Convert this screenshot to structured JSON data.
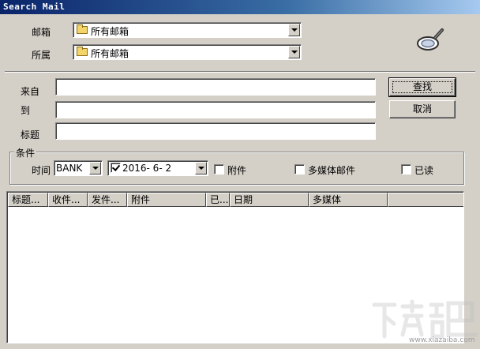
{
  "window": {
    "title": "Search Mail"
  },
  "fields": {
    "mailbox_label": "邮箱",
    "mailbox_value": "所有邮箱",
    "belongs_label": "所属",
    "belongs_value": "所有邮箱",
    "from_label": "来自",
    "to_label": "到",
    "subject_label": "标题",
    "from_value": "",
    "to_value": "",
    "subject_value": ""
  },
  "buttons": {
    "search": "查找",
    "cancel": "取消"
  },
  "conditions": {
    "group_label": "条件",
    "time_label": "时间",
    "time_value": "BANK",
    "date_checked": true,
    "date_value": "2016-  6-  2",
    "attachment_label": "附件",
    "attachment_checked": false,
    "multimedia_label": "多媒体邮件",
    "multimedia_checked": false,
    "read_label": "已读",
    "read_checked": false
  },
  "table": {
    "columns": [
      "标题...",
      "收件...",
      "发件...",
      "附件",
      "已...",
      "日期",
      "多媒体",
      ""
    ],
    "rows": []
  },
  "watermark": {
    "text": "www.xiazaiba.com"
  },
  "icons": {
    "search": "magnifier-icon",
    "folder": "folder-icon"
  }
}
